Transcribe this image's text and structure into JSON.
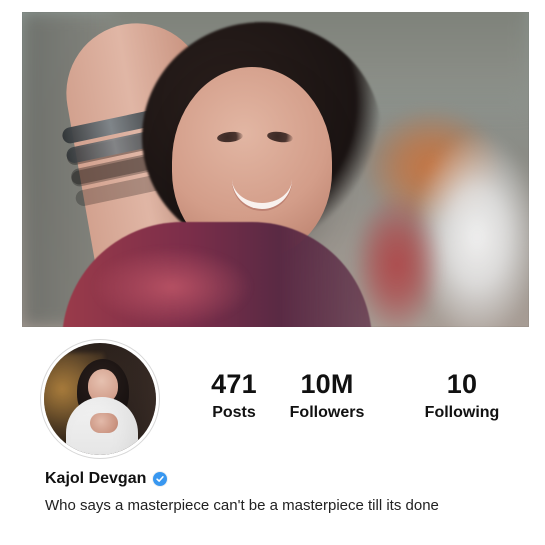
{
  "profile": {
    "display_name": "Kajol Devgan",
    "bio": "Who says a masterpiece can't be a masterpiece till its done",
    "verified_icon": "verified-badge-icon",
    "verified_color": "#3897f0"
  },
  "stats": {
    "posts": {
      "value": "471",
      "label": "Posts"
    },
    "followers": {
      "value": "10M",
      "label": "Followers"
    },
    "following": {
      "value": "10",
      "label": "Following"
    }
  }
}
